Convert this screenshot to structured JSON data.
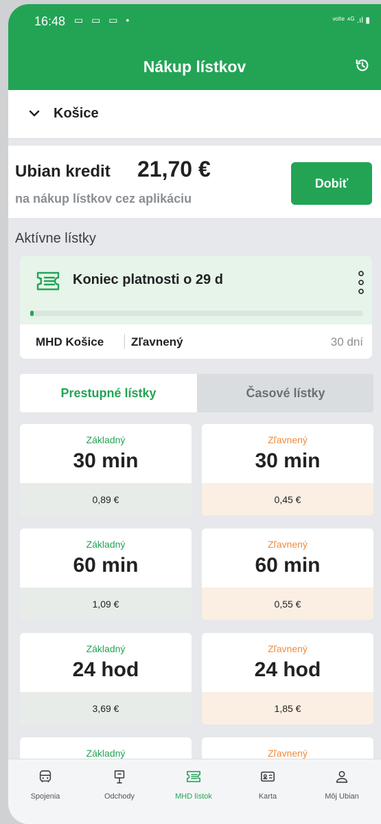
{
  "status_bar": {
    "time": "16:48",
    "icons": "▭ ▭ ▭ •",
    "right": "ᵛᵒˡᵗᵉ ⁴ᴳ .ıl ▮"
  },
  "header": {
    "title": "Nákup lístkov",
    "history_icon": "history-icon"
  },
  "city": {
    "name": "Košice",
    "icon": "chevron-down-icon"
  },
  "credit": {
    "label": "Ubian kredit",
    "value": "21,70 €",
    "subtitle": "na nákup lístkov cez aplikáciu",
    "topup_label": "Dobiť"
  },
  "active_section": {
    "title": "Aktívne lístky"
  },
  "active_ticket": {
    "title": "Koniec platnosti o 29 d",
    "progress": 0.01,
    "city": "MHD Košice",
    "type": "Zľavnený",
    "duration": "30 dní"
  },
  "tabs": [
    {
      "label": "Prestupné lístky"
    },
    {
      "label": "Časové lístky"
    }
  ],
  "tickets": [
    {
      "category": "Základný",
      "duration": "30 min",
      "price": "0,89 €"
    },
    {
      "category": "Zľavnený",
      "duration": "30 min",
      "price": "0,45 €"
    },
    {
      "category": "Základný",
      "duration": "60 min",
      "price": "1,09 €"
    },
    {
      "category": "Zľavnený",
      "duration": "60 min",
      "price": "0,55 €"
    },
    {
      "category": "Základný",
      "duration": "24 hod",
      "price": "3,69 €"
    },
    {
      "category": "Zľavnený",
      "duration": "24 hod",
      "price": "1,85 €"
    },
    {
      "category": "Základný"
    },
    {
      "category": "Zľavnený"
    }
  ],
  "nav": [
    {
      "label": "Spojenia",
      "icon": "bus-icon"
    },
    {
      "label": "Odchody",
      "icon": "stop-sign-icon"
    },
    {
      "label": "MHD lístok",
      "icon": "ticket-icon"
    },
    {
      "label": "Karta",
      "icon": "card-icon"
    },
    {
      "label": "Môj Ubian",
      "icon": "user-icon"
    }
  ],
  "colors": {
    "accent": "#23a455",
    "discount": "#ef8a3c"
  }
}
